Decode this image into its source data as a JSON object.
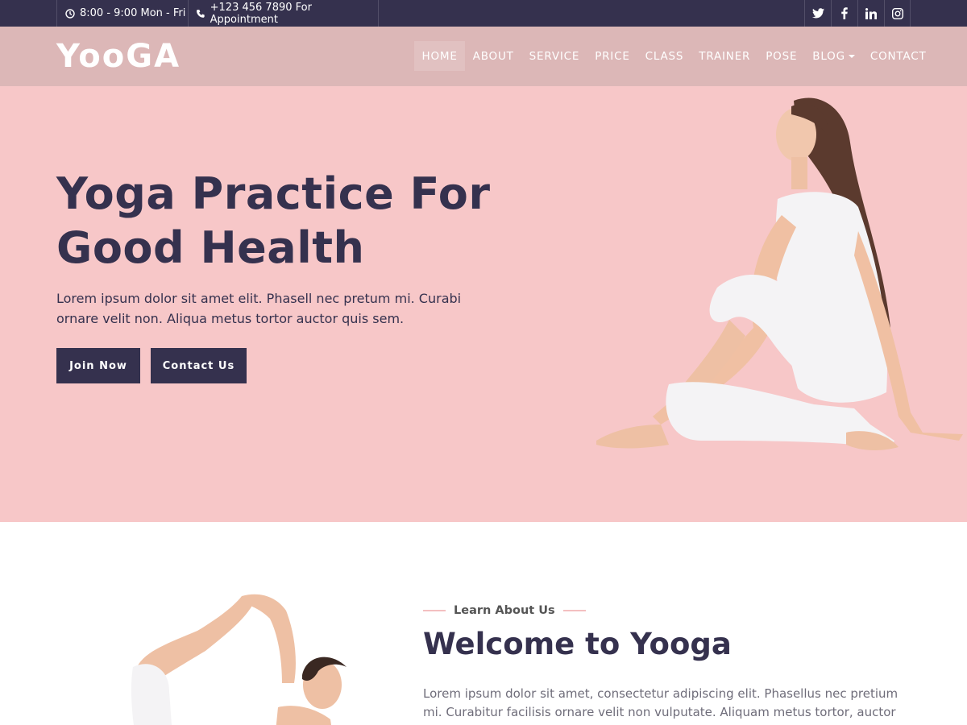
{
  "topbar": {
    "hours": "8:00 - 9:00 Mon - Fri",
    "phone": "+123 456 7890 For Appointment",
    "social": [
      "twitter-icon",
      "facebook-icon",
      "linkedin-icon",
      "instagram-icon"
    ]
  },
  "navbar": {
    "logo": "YooGA",
    "items": [
      {
        "label": "HOME",
        "active": true
      },
      {
        "label": "ABOUT"
      },
      {
        "label": "SERVICE"
      },
      {
        "label": "PRICE"
      },
      {
        "label": "CLASS"
      },
      {
        "label": "TRAINER"
      },
      {
        "label": "POSE"
      },
      {
        "label": "BLOG",
        "dropdown": true
      },
      {
        "label": "CONTACT"
      }
    ]
  },
  "hero": {
    "title_line1": "Yoga Practice For",
    "title_line2": "Good Health",
    "text": "Lorem ipsum dolor sit amet elit. Phasell nec pretum mi. Curabi ornare velit non. Aliqua metus tortor auctor quis sem.",
    "join_label": "Join Now",
    "contact_label": "Contact Us"
  },
  "about": {
    "subtitle": "Learn About Us",
    "title": "Welcome to Yooga",
    "text": "Lorem ipsum dolor sit amet, consectetur adipiscing elit. Phasellus nec pretium mi. Curabitur facilisis ornare velit non vulputate. Aliquam metus tortor, auctor id"
  },
  "colors": {
    "dark": "#35314e",
    "navbar": "#dcb7b7",
    "hero_bg": "#f7c7c8",
    "accent_line": "#f3bfc0"
  }
}
